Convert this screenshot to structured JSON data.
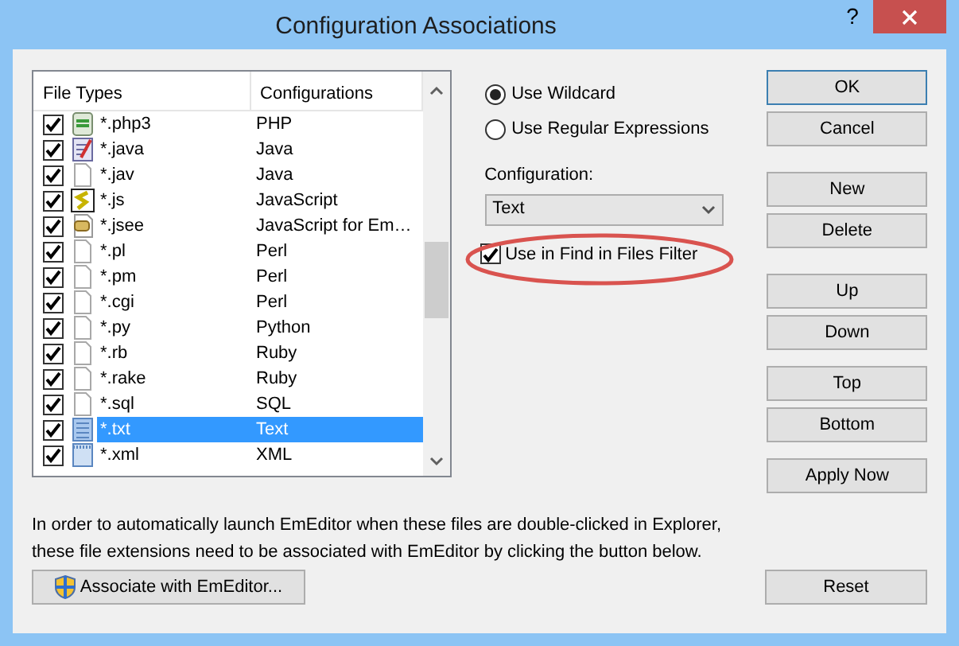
{
  "window": {
    "title": "Configuration Associations",
    "help_button": "?"
  },
  "file_list": {
    "columns": [
      "File Types",
      "Configurations"
    ],
    "rows": [
      {
        "checked": true,
        "kind": "php",
        "file_type": "*.php3",
        "configuration": "PHP",
        "selected": false
      },
      {
        "checked": true,
        "kind": "java",
        "file_type": "*.java",
        "configuration": "Java",
        "selected": false
      },
      {
        "checked": true,
        "kind": "blank",
        "file_type": "*.jav",
        "configuration": "Java",
        "selected": false
      },
      {
        "checked": true,
        "kind": "script",
        "file_type": "*.js",
        "configuration": "JavaScript",
        "selected": false
      },
      {
        "checked": true,
        "kind": "scroll",
        "file_type": "*.jsee",
        "configuration": "JavaScript for Em…",
        "selected": false
      },
      {
        "checked": true,
        "kind": "blank",
        "file_type": "*.pl",
        "configuration": "Perl",
        "selected": false
      },
      {
        "checked": true,
        "kind": "blank",
        "file_type": "*.pm",
        "configuration": "Perl",
        "selected": false
      },
      {
        "checked": true,
        "kind": "blank",
        "file_type": "*.cgi",
        "configuration": "Perl",
        "selected": false
      },
      {
        "checked": true,
        "kind": "blank",
        "file_type": "*.py",
        "configuration": "Python",
        "selected": false
      },
      {
        "checked": true,
        "kind": "blank",
        "file_type": "*.rb",
        "configuration": "Ruby",
        "selected": false
      },
      {
        "checked": true,
        "kind": "blank",
        "file_type": "*.rake",
        "configuration": "Ruby",
        "selected": false
      },
      {
        "checked": true,
        "kind": "blank",
        "file_type": "*.sql",
        "configuration": "SQL",
        "selected": false
      },
      {
        "checked": true,
        "kind": "text",
        "file_type": "*.txt",
        "configuration": "Text",
        "selected": true
      },
      {
        "checked": true,
        "kind": "xml",
        "file_type": "*.xml",
        "configuration": "XML",
        "selected": false
      }
    ]
  },
  "match_mode": [
    {
      "label": "Use Wildcard",
      "selected": true
    },
    {
      "label": "Use Regular Expressions",
      "selected": false
    }
  ],
  "configuration": {
    "label": "Configuration:",
    "value": "Text"
  },
  "find_in_files_filter": {
    "label": "Use in Find in Files Filter",
    "checked": true
  },
  "button_groups": [
    {
      "buttons": [
        {
          "label": "OK",
          "default": true
        },
        {
          "label": "Cancel",
          "default": false
        }
      ]
    },
    {
      "buttons": [
        {
          "label": "New",
          "default": false
        },
        {
          "label": "Delete",
          "default": false
        }
      ]
    },
    {
      "buttons": [
        {
          "label": "Up",
          "default": false
        },
        {
          "label": "Down",
          "default": false
        }
      ]
    },
    {
      "buttons": [
        {
          "label": "Top",
          "default": false
        },
        {
          "label": "Bottom",
          "default": false
        }
      ]
    },
    {
      "buttons": [
        {
          "label": "Apply Now",
          "default": false
        }
      ]
    }
  ],
  "info_text": "In order to automatically launch EmEditor when these files are double-clicked in Explorer, these file extensions need to be associated with EmEditor by clicking the button below.",
  "associate_button": "Associate with EmEditor...",
  "reset_button": "Reset"
}
